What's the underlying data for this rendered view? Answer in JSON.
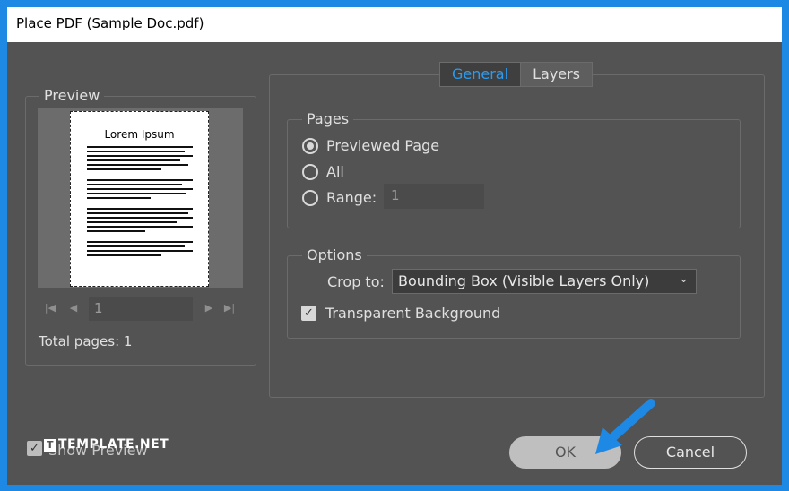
{
  "window": {
    "title": "Place PDF (Sample Doc.pdf)"
  },
  "preview": {
    "legend": "Preview",
    "thumbnail_title": "Lorem Ipsum",
    "page_field_value": "1",
    "total_pages_text": "Total pages: 1"
  },
  "tabs": [
    {
      "label": "General",
      "active": true
    },
    {
      "label": "Layers",
      "active": false
    }
  ],
  "pages": {
    "legend": "Pages",
    "options": [
      {
        "label": "Previewed Page",
        "selected": true
      },
      {
        "label": "All",
        "selected": false
      },
      {
        "label": "Range:",
        "selected": false
      }
    ],
    "range_value": "1"
  },
  "options": {
    "legend": "Options",
    "crop_label": "Crop to:",
    "crop_value": "Bounding Box (Visible Layers Only)",
    "transparent_background_label": "Transparent Background",
    "transparent_background_checked": true
  },
  "footer": {
    "show_preview_label": "Show Preview",
    "show_preview_checked": true,
    "watermark": "TEMPLATE.NET",
    "ok_label": "OK",
    "cancel_label": "Cancel"
  },
  "colors": {
    "frame_blue": "#1e88e5",
    "dialog_bg": "#535353",
    "active_tab_text": "#2d9cf0",
    "arrow": "#1e88e5"
  }
}
